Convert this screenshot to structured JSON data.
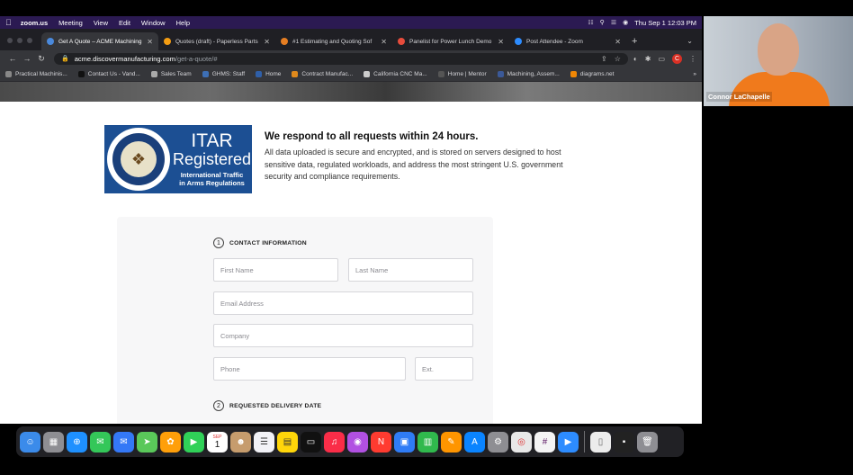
{
  "menubar": {
    "app": "zoom.us",
    "items": [
      "Meeting",
      "View",
      "Edit",
      "Window",
      "Help"
    ],
    "clock": "Thu Sep 1  12:03 PM"
  },
  "tabs": [
    {
      "label": "Get A Quote – ACME Machining",
      "color": "#4a89dc"
    },
    {
      "label": "Quotes (draft) - Paperless Parts",
      "color": "#f39c12"
    },
    {
      "label": "#1 Estimating and Quoting Sof",
      "color": "#e67e22"
    },
    {
      "label": "Panelist for Power Lunch Demo",
      "color": "#e74c3c"
    },
    {
      "label": "Post Attendee - Zoom",
      "color": "#2d8cff"
    }
  ],
  "address": {
    "host": "acme.discovermanufacturing.com",
    "path": "/get-a-quote/#"
  },
  "profile_initial": "C",
  "bookmarks": [
    {
      "label": "Practical Machinis...",
      "color": "#888"
    },
    {
      "label": "Contact Us - Vand...",
      "color": "#111"
    },
    {
      "label": "Sales Team",
      "color": "#aaa"
    },
    {
      "label": "GHMS: Staff",
      "color": "#3d6fb5"
    },
    {
      "label": "Home",
      "color": "#2f5fa8"
    },
    {
      "label": "Contract Manufac...",
      "color": "#e08a1c"
    },
    {
      "label": "California CNC Ma...",
      "color": "#ccc"
    },
    {
      "label": "Home | Mentor",
      "color": "#555"
    },
    {
      "label": "Machining, Assem...",
      "color": "#3b5998"
    },
    {
      "label": "diagrams.net",
      "color": "#f08705"
    }
  ],
  "itar": {
    "line1": "ITAR",
    "line2": "Registered",
    "line3": "International Traffic",
    "line4": "in Arms Regulations",
    "heading": "We respond to all requests within 24 hours.",
    "body": "All data uploaded is secure and encrypted, and is stored on servers designed to host sensitive data, regulated workloads, and address the most stringent U.S. government security and compliance requirements."
  },
  "form": {
    "section1": {
      "num": "1",
      "title": "CONTACT INFORMATION"
    },
    "section2": {
      "num": "2",
      "title": "REQUESTED DELIVERY DATE"
    },
    "placeholders": {
      "first_name": "First Name",
      "last_name": "Last Name",
      "email": "Email Address",
      "company": "Company",
      "phone": "Phone",
      "ext": "Ext."
    }
  },
  "dock": {
    "apps": [
      {
        "name": "finder",
        "color": "#3b8bea"
      },
      {
        "name": "launchpad",
        "color": "#8e8e93"
      },
      {
        "name": "safari",
        "color": "#1e90ff"
      },
      {
        "name": "messages",
        "color": "#34c759"
      },
      {
        "name": "mail",
        "color": "#3478f6"
      },
      {
        "name": "maps",
        "color": "#5ac85a"
      },
      {
        "name": "photos",
        "color": "#ff9f0a"
      },
      {
        "name": "facetime",
        "color": "#30d158"
      },
      {
        "name": "calendar",
        "color": "#ffffff"
      },
      {
        "name": "contacts",
        "color": "#c69c6d"
      },
      {
        "name": "reminders",
        "color": "#f2f2f7"
      },
      {
        "name": "notes",
        "color": "#ffd60a"
      },
      {
        "name": "tv",
        "color": "#111"
      },
      {
        "name": "music",
        "color": "#fa2d48"
      },
      {
        "name": "podcasts",
        "color": "#b150e2"
      },
      {
        "name": "news",
        "color": "#ff3b30"
      },
      {
        "name": "keynote",
        "color": "#2f7cf6"
      },
      {
        "name": "numbers",
        "color": "#30b94d"
      },
      {
        "name": "pages",
        "color": "#ff9500"
      },
      {
        "name": "app-store",
        "color": "#0a84ff"
      },
      {
        "name": "system-preferences",
        "color": "#8e8e93"
      },
      {
        "name": "chrome",
        "color": "#e8e8e8"
      },
      {
        "name": "slack",
        "color": "#f4f4f4"
      },
      {
        "name": "zoom",
        "color": "#2d8cff"
      }
    ],
    "calendar_day": "1",
    "calendar_month": "SEP"
  },
  "zoom": {
    "participant_name": "Connor LaChapelle"
  }
}
